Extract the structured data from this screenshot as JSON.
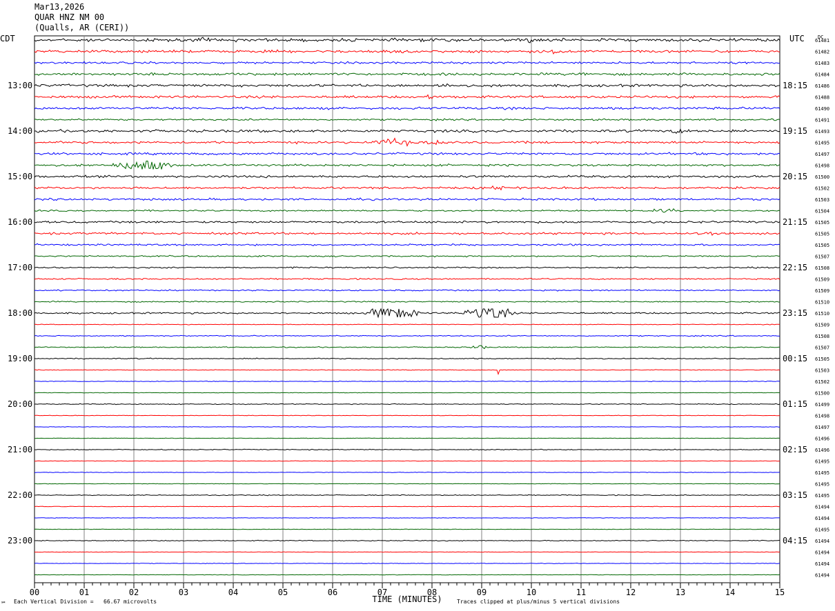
{
  "header": {
    "date": "Mar13,2026",
    "station": "QUAR HNZ NM 00",
    "location": "(Qualls, AR (CERI))"
  },
  "labels": {
    "left_tz": "CDT",
    "right_tz": "UTC",
    "dc_title": "DC",
    "xlabel": "TIME (MINUTES)",
    "scale_note": "Each Vertical Division =   66.67 microvolts",
    "clip_note": "Traces clipped at plus/minus 5 vertical divisions",
    "corner_mark": "℠"
  },
  "chart_data": {
    "type": "line",
    "x_ticks": [
      "00",
      "01",
      "02",
      "03",
      "04",
      "05",
      "06",
      "07",
      "08",
      "09",
      "10",
      "11",
      "12",
      "13",
      "14",
      "15"
    ],
    "xlim": [
      0,
      15
    ],
    "trace_count": 48,
    "trace_colors": [
      "#000000",
      "#ff0000",
      "#0000ff",
      "#006600"
    ],
    "left_hour_labels": [
      "13:00",
      "14:00",
      "15:00",
      "16:00",
      "17:00",
      "18:00",
      "19:00",
      "20:00",
      "21:00",
      "22:00",
      "23:00"
    ],
    "right_hour_labels": [
      "18:15",
      "19:15",
      "20:15",
      "21:15",
      "22:15",
      "23:15",
      "00:15",
      "01:15",
      "02:15",
      "03:15",
      "04:15"
    ],
    "dc_offsets": [
      "61481",
      "61482",
      "61483",
      "61484",
      "61486",
      "61488",
      "61490",
      "61491",
      "61493",
      "61495",
      "61497",
      "61498",
      "61500",
      "61502",
      "61503",
      "61504",
      "61505",
      "61505",
      "61505",
      "61507",
      "61508",
      "61509",
      "61509",
      "61510",
      "61510",
      "61509",
      "61508",
      "61507",
      "61505",
      "61503",
      "61502",
      "61500",
      "61499",
      "61498",
      "61497",
      "61496",
      "61496",
      "61495",
      "61495",
      "61495",
      "61495",
      "61494",
      "61494",
      "61495",
      "61494",
      "61494",
      "61494",
      "61494"
    ],
    "noise_levels": [
      1.8,
      1.5,
      1.2,
      1.4,
      1.5,
      1.4,
      1.4,
      1.0,
      1.5,
      1.3,
      1.3,
      1.2,
      1.3,
      1.2,
      1.2,
      0.9,
      1.2,
      1.2,
      1.0,
      0.8,
      0.8,
      0.8,
      0.8,
      0.7,
      0.9,
      0.4,
      0.6,
      0.6,
      0.6,
      0.4,
      0.4,
      0.3,
      0.5,
      0.3,
      0.3,
      0.3,
      0.5,
      0.3,
      0.3,
      0.3,
      0.5,
      0.3,
      0.3,
      0.3,
      0.5,
      0.3,
      0.3,
      0.3
    ],
    "events": [
      {
        "trace": 0,
        "minute": 3.4,
        "amp": 3,
        "dur": 0.3
      },
      {
        "trace": 0,
        "minute": 10.0,
        "amp": 5,
        "dur": 0.2
      },
      {
        "trace": 1,
        "minute": 7.2,
        "amp": 3,
        "dur": 0.5
      },
      {
        "trace": 1,
        "minute": 10.5,
        "amp": 3,
        "dur": 0.5
      },
      {
        "trace": 3,
        "minute": 11.0,
        "amp": 3,
        "dur": 0.4
      },
      {
        "trace": 4,
        "minute": 8.3,
        "amp": 3,
        "dur": 0.5
      },
      {
        "trace": 5,
        "minute": 8.0,
        "amp": 3,
        "dur": 0.5
      },
      {
        "trace": 6,
        "minute": 12.0,
        "amp": 3,
        "dur": 0.3
      },
      {
        "trace": 8,
        "minute": 13.0,
        "amp": 3,
        "dur": 0.5
      },
      {
        "trace": 9,
        "minute": 7.2,
        "amp": 5,
        "dur": 0.6
      },
      {
        "trace": 9,
        "minute": 8.1,
        "amp": 4,
        "dur": 0.5
      },
      {
        "trace": 11,
        "minute": 2.2,
        "amp": 9,
        "dur": 0.7
      },
      {
        "trace": 13,
        "minute": 9.3,
        "amp": 3,
        "dur": 0.6
      },
      {
        "trace": 15,
        "minute": 12.7,
        "amp": 3,
        "dur": 0.4
      },
      {
        "trace": 17,
        "minute": 13.6,
        "amp": 3,
        "dur": 0.4
      },
      {
        "trace": 24,
        "minute": 7.2,
        "amp": 10,
        "dur": 0.6
      },
      {
        "trace": 24,
        "minute": 9.1,
        "amp": 11,
        "dur": 0.6
      },
      {
        "trace": 27,
        "minute": 8.9,
        "amp": 3,
        "dur": 0.3
      },
      {
        "trace": 29,
        "minute": 9.33,
        "amp": 8,
        "dur": 0.02
      }
    ]
  }
}
